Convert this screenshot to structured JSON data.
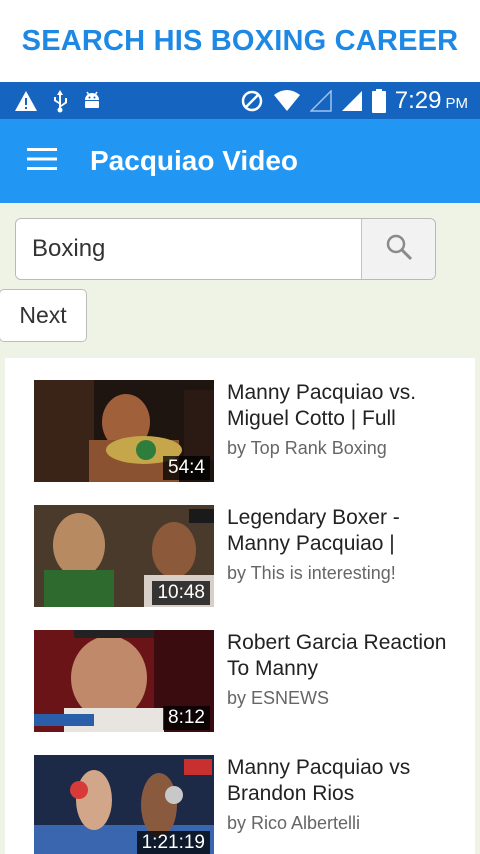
{
  "banner": {
    "text": "SEARCH HIS BOXING CAREER"
  },
  "status_bar": {
    "time": "7:29",
    "ampm": "PM"
  },
  "app_bar": {
    "title": "Pacquiao Video"
  },
  "search": {
    "value": "Boxing"
  },
  "pager": {
    "next_label": "Next"
  },
  "videos": [
    {
      "title": "Manny Pacquiao vs. Miguel Cotto | Full",
      "author": "by Top Rank Boxing",
      "duration": "54:4"
    },
    {
      "title": "Legendary Boxer - Manny Pacquiao |",
      "author": "by This is interesting!",
      "duration": "10:48"
    },
    {
      "title": "Robert Garcia Reaction To Manny",
      "author": "by ESNEWS",
      "duration": "8:12"
    },
    {
      "title": "Manny Pacquiao vs Brandon Rios",
      "author": "by Rico Albertelli",
      "duration": "1:21:19"
    }
  ],
  "colors": {
    "banner_text": "#1e88e5",
    "status_bar": "#1565c0",
    "app_bar": "#2196f3",
    "background": "#eef3e6"
  }
}
